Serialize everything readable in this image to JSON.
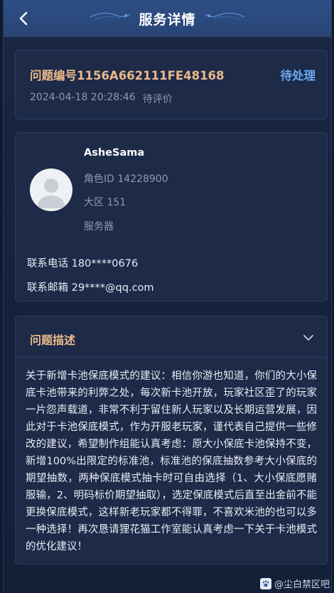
{
  "header": {
    "title": "服务详情"
  },
  "ticket": {
    "number": "问题编号1156A662111FE48168",
    "status": "待处理",
    "datetime": "2024-04-18 20:28:46",
    "review_status": "待评价"
  },
  "user": {
    "name": "AsheSama",
    "role_id": "角色ID 14228900",
    "region": "大区 151",
    "server": "服务器",
    "phone": "联系电话 180****0676",
    "email": "联系邮箱 29****@qq.com"
  },
  "description": {
    "title": "问题描述",
    "body": "关于新增卡池保底模式的建议：相信你游也知道，你们的大小保底卡池带来的利弊之处，每次新卡池开放，玩家社区歪了的玩家一片怨声载道，非常不利于留住新人玩家以及长期运营发展，因此对于卡池保底模式，作为开服老玩家，谨代表自己提供一些修改的建议，希望制作组能认真考虑：原大小保底卡池保持不变，新增100%出限定的标准池，标准池的保底抽数参考大小保底的期望抽数，两种保底模式抽卡时可自由选择（1、大小保底愿赌服输，2、明码标价期望抽取），选定保底模式后直至出金前不能更换保底模式，这样新老玩家都不得罪，不喜欢米池的也可以多一种选择！再次恳请狸花猫工作室能认真考虑一下关于卡池模式的优化建议！"
  },
  "watermark": {
    "text": "@尘白禁区吧"
  },
  "colors": {
    "accent_orange": "#e9b98a",
    "status_blue": "#6aa8f0",
    "header_bg": "#2e4f86",
    "card_bg": "#1d2a48"
  },
  "icons": {
    "back": "chevron-left-icon",
    "collapse": "chevron-down-icon",
    "avatar": "default-avatar-icon"
  }
}
